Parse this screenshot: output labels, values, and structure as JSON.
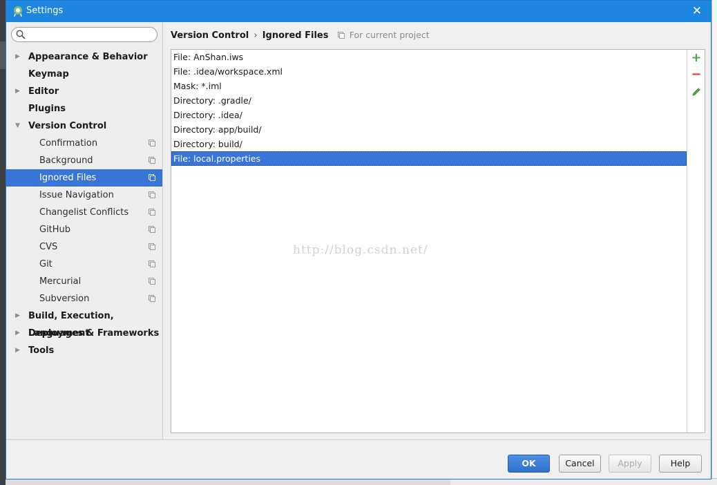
{
  "window": {
    "title": "Settings"
  },
  "search": {
    "placeholder": "",
    "value": ""
  },
  "tree": [
    {
      "label": "Appearance & Behavior",
      "level": 0,
      "expandable": true,
      "expanded": false
    },
    {
      "label": "Keymap",
      "level": 0,
      "expandable": false
    },
    {
      "label": "Editor",
      "level": 0,
      "expandable": true,
      "expanded": false
    },
    {
      "label": "Plugins",
      "level": 0,
      "expandable": false
    },
    {
      "label": "Version Control",
      "level": 0,
      "expandable": true,
      "expanded": true
    },
    {
      "label": "Confirmation",
      "level": 1,
      "project_scope": true
    },
    {
      "label": "Background",
      "level": 1,
      "project_scope": true
    },
    {
      "label": "Ignored Files",
      "level": 1,
      "project_scope": true,
      "selected": true
    },
    {
      "label": "Issue Navigation",
      "level": 1,
      "project_scope": true
    },
    {
      "label": "Changelist Conflicts",
      "level": 1,
      "project_scope": true
    },
    {
      "label": "GitHub",
      "level": 1,
      "project_scope": true
    },
    {
      "label": "CVS",
      "level": 1,
      "project_scope": true
    },
    {
      "label": "Git",
      "level": 1,
      "project_scope": true
    },
    {
      "label": "Mercurial",
      "level": 1,
      "project_scope": true
    },
    {
      "label": "Subversion",
      "level": 1,
      "project_scope": true
    },
    {
      "label": "Build, Execution, Deployment",
      "level": 0,
      "expandable": true,
      "expanded": false
    },
    {
      "label": "Languages & Frameworks",
      "level": 0,
      "expandable": true,
      "expanded": false
    },
    {
      "label": "Tools",
      "level": 0,
      "expandable": true,
      "expanded": false
    }
  ],
  "breadcrumb": {
    "parent": "Version Control",
    "separator": "›",
    "current": "Ignored Files",
    "scope": "For current project"
  },
  "ignored_files": [
    "File: AnShan.iws",
    "File: .idea/workspace.xml",
    "Mask: *.iml",
    "Directory: .gradle/",
    "Directory: .idea/",
    "Directory: app/build/",
    "Directory: build/",
    "File: local.properties"
  ],
  "selected_index": 7,
  "toolbar": {
    "add": "+",
    "remove": "−"
  },
  "watermark": "http://blog.csdn.net/",
  "buttons": {
    "ok": "OK",
    "cancel": "Cancel",
    "apply": "Apply",
    "help": "Help"
  },
  "colors": {
    "titlebar": "#1f86e0",
    "selection": "#3875d6",
    "add": "#3fae3f",
    "remove": "#d83b3b",
    "edit": "#59a83a"
  }
}
